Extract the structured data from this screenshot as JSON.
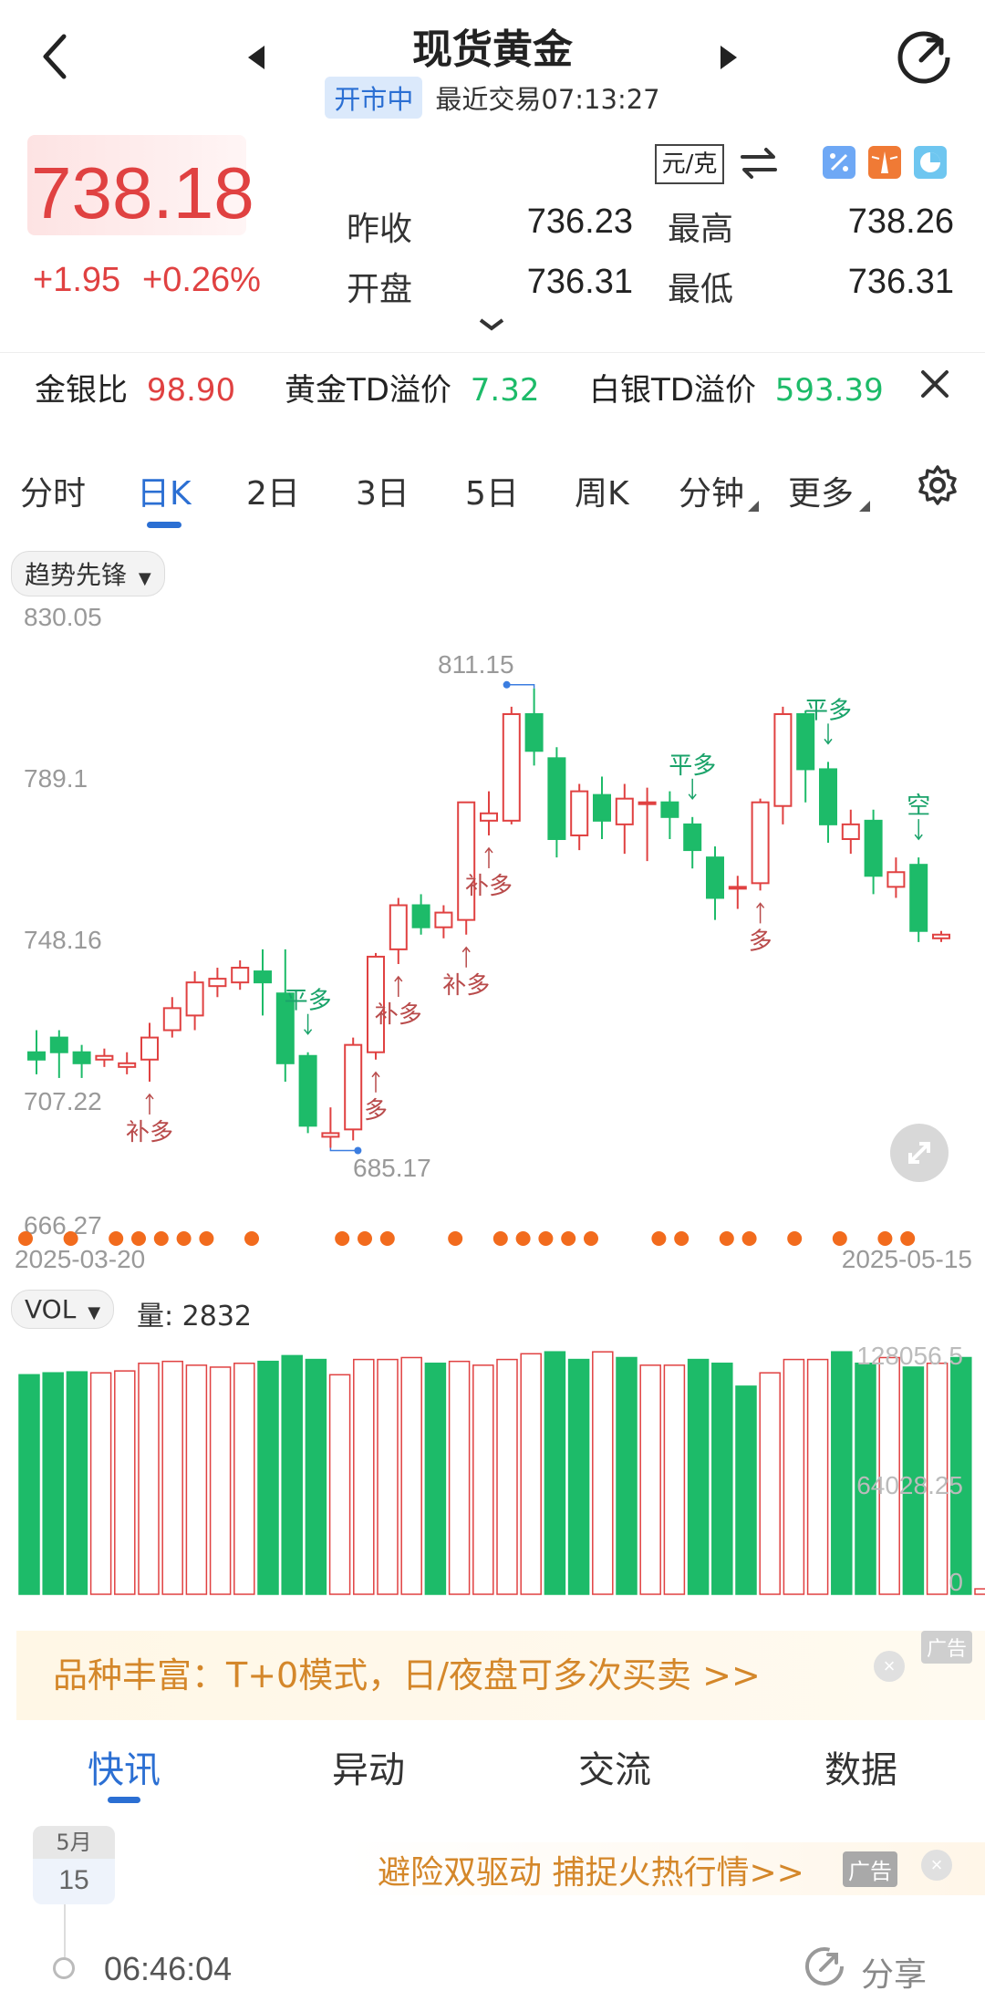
{
  "header": {
    "title": "现货黄金",
    "status": "开市中",
    "last_trade": "最近交易07:13:27"
  },
  "quote": {
    "price": "738.18",
    "change": "+1.95",
    "change_pct": "+0.26%",
    "unit": "元/克",
    "prev_close_label": "昨收",
    "prev_close": "736.23",
    "high_label": "最高",
    "high": "738.26",
    "open_label": "开盘",
    "open": "736.31",
    "low_label": "最低",
    "low": "736.31"
  },
  "ratios": {
    "gold_silver_label": "金银比",
    "gold_silver": "98.90",
    "gold_td_label": "黄金TD溢价",
    "gold_td": "7.32",
    "silver_td_label": "白银TD溢价",
    "silver_td": "593.39"
  },
  "tabs": [
    "分时",
    "日K",
    "2日",
    "3日",
    "5日",
    "周K",
    "分钟",
    "更多"
  ],
  "active_tab": "日K",
  "indicator_chip": "趋势先锋",
  "chart": {
    "y_labels": [
      "830.05",
      "789.1",
      "748.16",
      "707.22",
      "666.27"
    ],
    "max_label": "811.15",
    "min_label": "685.17",
    "start_date": "2025-03-20",
    "end_date": "2025-05-15",
    "signals": {
      "bu_duo": "补多",
      "ping_duo": "平多",
      "duo": "多",
      "kong": "空"
    }
  },
  "volume": {
    "chip": "VOL",
    "label": "量: 2832",
    "y_labels": [
      "128056.5",
      "64028.25",
      "0"
    ]
  },
  "ad": {
    "text": "品种丰富：T+0模式，日/夜盘可多次买卖 >>",
    "tag": "广告"
  },
  "bottom_tabs": [
    "快讯",
    "异动",
    "交流",
    "数据"
  ],
  "news": {
    "month": "5月",
    "day": "15",
    "ad_text": "避险双驱动 捕捉火热行情>>",
    "ad_tag": "广告",
    "time": "06:46:04",
    "share": "分享"
  },
  "colors": {
    "up": "#e04141",
    "down": "#1dbb69",
    "accent": "#2b6fd3",
    "dot": "#f26b1d"
  },
  "chart_data": {
    "type": "candlestick",
    "x_start": "2025-03-20",
    "x_end": "2025-05-15",
    "ylim": [
      666.27,
      830.05
    ],
    "candles": [
      [
        712,
        710,
        718,
        706
      ],
      [
        716,
        712,
        718,
        705
      ],
      [
        712,
        709,
        714,
        705
      ],
      [
        710,
        711,
        713,
        708
      ],
      [
        708,
        709,
        712,
        706
      ],
      [
        710,
        716,
        720,
        704
      ],
      [
        718,
        724,
        727,
        716
      ],
      [
        722,
        731,
        734,
        718
      ],
      [
        730,
        732,
        735,
        727
      ],
      [
        731,
        735,
        737,
        729
      ],
      [
        734,
        731,
        740,
        722
      ],
      [
        728,
        709,
        740,
        704
      ],
      [
        711,
        692,
        712,
        690
      ],
      [
        689,
        690,
        697,
        686
      ],
      [
        691,
        714,
        716,
        688
      ],
      [
        712,
        738,
        739,
        710
      ],
      [
        740,
        752,
        754,
        736
      ],
      [
        752,
        746,
        755,
        744
      ],
      [
        746,
        750,
        752,
        743
      ],
      [
        748,
        780,
        780,
        744
      ],
      [
        775,
        777,
        783,
        771
      ],
      [
        775,
        804,
        806,
        774
      ],
      [
        804,
        794,
        811,
        790
      ],
      [
        792,
        770,
        795,
        765
      ],
      [
        771,
        783,
        785,
        767
      ],
      [
        782,
        775,
        787,
        770
      ],
      [
        774,
        781,
        785,
        766
      ],
      [
        780,
        780,
        784,
        764
      ],
      [
        780,
        776,
        783,
        770
      ],
      [
        774,
        767,
        776,
        762
      ],
      [
        765,
        754,
        768,
        748
      ],
      [
        757,
        757,
        760,
        751
      ],
      [
        758,
        780,
        781,
        756
      ],
      [
        779,
        804,
        806,
        774
      ],
      [
        804,
        789,
        805,
        780
      ],
      [
        789,
        774,
        791,
        769
      ],
      [
        770,
        774,
        778,
        766
      ],
      [
        775,
        760,
        778,
        755
      ],
      [
        757,
        761,
        765,
        754
      ],
      [
        763,
        745,
        765,
        742
      ],
      [
        743,
        744,
        745,
        742
      ]
    ],
    "volumes": [
      115000,
      116000,
      116500,
      116000,
      117000,
      121000,
      122000,
      120000,
      119000,
      121000,
      122000,
      125000,
      123000,
      115000,
      123000,
      123000,
      124000,
      121000,
      122000,
      120000,
      123000,
      126000,
      127000,
      123000,
      127000,
      124000,
      120000,
      120000,
      123000,
      121000,
      109000,
      116000,
      123000,
      123000,
      127000,
      121000,
      124000,
      119000,
      121000,
      124000,
      2832
    ],
    "vol_ylim": [
      0,
      128056.5
    ]
  }
}
